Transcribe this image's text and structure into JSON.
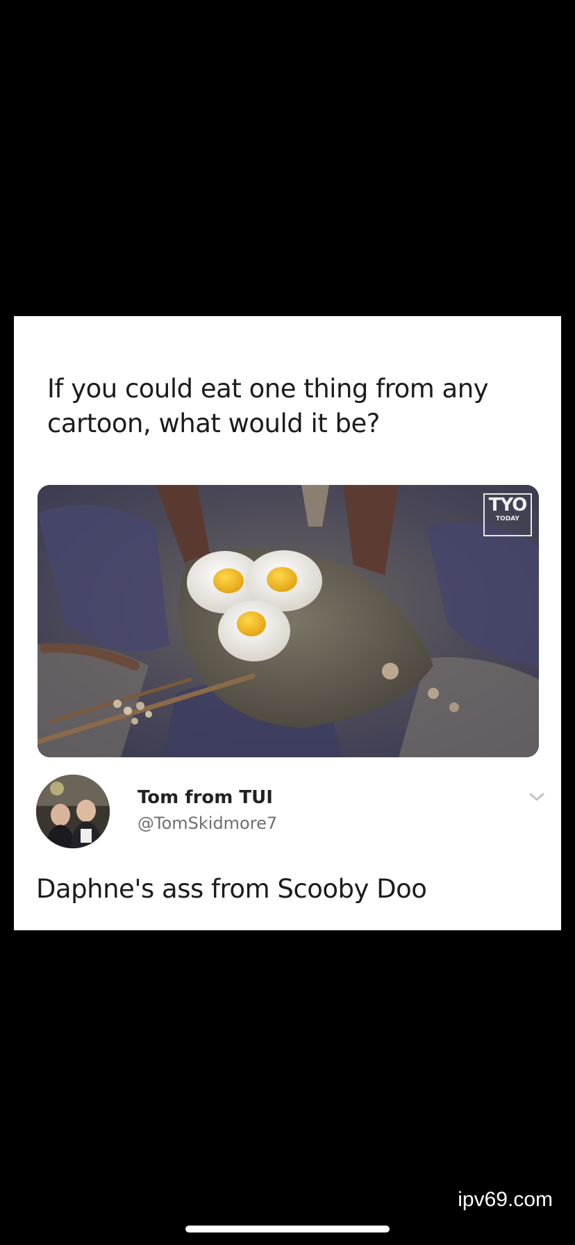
{
  "post": {
    "question": "If you could eat one thing from any cartoon, what would it be?",
    "image": {
      "description_icon": "fried-eggs-on-rock-photo",
      "logo_big": "TYO",
      "logo_small": "TODAY"
    },
    "reply": {
      "author_name": "Tom from TUI",
      "author_handle": "@TomSkidmore7",
      "text": "Daphne's ass from Scooby Doo"
    }
  },
  "footer": {
    "watermark": "ipv69.com"
  },
  "colors": {
    "background": "#000000",
    "card": "#ffffff",
    "text": "#1b1b1b",
    "handle": "#6f6f6f"
  }
}
